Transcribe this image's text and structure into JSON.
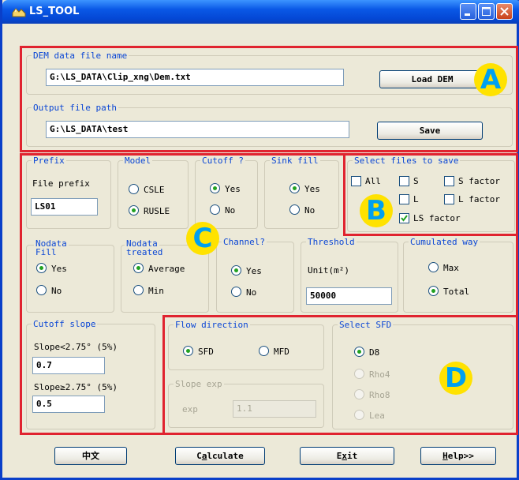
{
  "window": {
    "title": "LS_TOOL"
  },
  "dem": {
    "legend": "DEM data file name",
    "value": "G:\\LS_DATA\\Clip_xng\\Dem.txt",
    "button": "Load DEM"
  },
  "output": {
    "legend": "Output file path",
    "value": "G:\\LS_DATA\\test",
    "button": "Save"
  },
  "prefix": {
    "legend": "Prefix",
    "label": "File prefix",
    "value": "LS01"
  },
  "model": {
    "legend": "Model",
    "options": [
      "CSLE",
      "RUSLE"
    ],
    "selected": "RUSLE"
  },
  "cutoff": {
    "legend": "Cutoff ?",
    "options": [
      "Yes",
      "No"
    ],
    "selected": "Yes"
  },
  "sink_fill": {
    "legend": "Sink fill",
    "options": [
      "Yes",
      "No"
    ],
    "selected": "Yes"
  },
  "select_files": {
    "legend": "Select files to save",
    "items": [
      {
        "label": "All",
        "checked": false
      },
      {
        "label": "S",
        "checked": false
      },
      {
        "label": "S factor",
        "checked": false
      },
      {
        "label": "L",
        "checked": false
      },
      {
        "label": "L factor",
        "checked": false
      },
      {
        "label": "LS factor",
        "checked": true
      }
    ]
  },
  "nodata_fill": {
    "legend_line1": "Nodata",
    "legend_line2": "Fill",
    "options": [
      "Yes",
      "No"
    ],
    "selected": "Yes"
  },
  "nodata_treated": {
    "legend_line1": "Nodata",
    "legend_line2": "treated",
    "options": [
      "Average",
      "Min"
    ],
    "selected": "Average"
  },
  "channel": {
    "legend": "Channel?",
    "options": [
      "Yes",
      "No"
    ],
    "selected": "Yes"
  },
  "threshold": {
    "legend": "Threshold",
    "label": "Unit(m²)",
    "value": "50000"
  },
  "cumulated": {
    "legend": "Cumulated way",
    "options": [
      "Max",
      "Total"
    ],
    "selected": "Total"
  },
  "cutoff_slope": {
    "legend": "Cutoff slope",
    "label1": "Slope<2.75° (5%)",
    "value1": "0.7",
    "label2": "Slope≥2.75° (5%)",
    "value2": "0.5"
  },
  "flow_direction": {
    "legend": "Flow direction",
    "options": [
      "SFD",
      "MFD"
    ],
    "selected": "SFD"
  },
  "slope_exp": {
    "legend": "Slope exp",
    "label": "exp",
    "value": "1.1"
  },
  "select_sfd": {
    "legend": "Select SFD",
    "options": [
      "D8",
      "Rho4",
      "Rho8",
      "Lea"
    ],
    "selected": "D8"
  },
  "buttons": {
    "chinese": "中文",
    "calculate_pre": "C",
    "calculate_ul": "a",
    "calculate_post": "lculate",
    "exit_pre": "E",
    "exit_ul": "x",
    "exit_post": "it",
    "help_pre": "",
    "help_ul": "H",
    "help_post": "elp>>"
  },
  "annotations": {
    "a": "A",
    "b": "B",
    "c": "C",
    "d": "D"
  },
  "colors": {
    "region_border": "#e0232f",
    "legend": "#0a46d5",
    "badge_fill": "#ffe200",
    "badge_text": "#00a0f0",
    "titlebar": "#0a58e6"
  }
}
